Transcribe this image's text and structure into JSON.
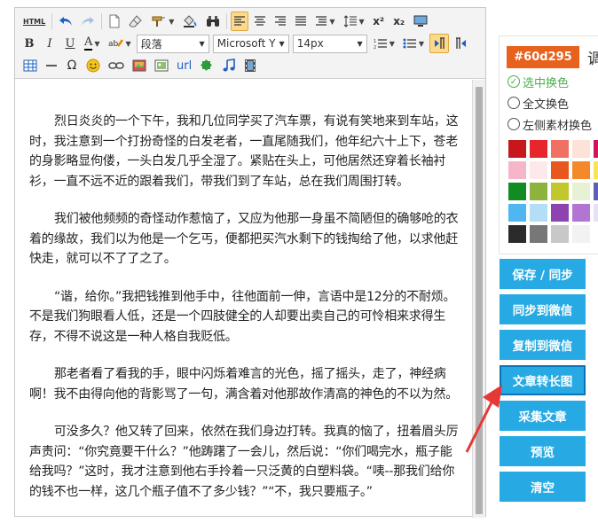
{
  "toolbar": {
    "html_label": "HTML",
    "paragraph_select": "段落",
    "font_select": "Microsoft Y",
    "size_select": "14px",
    "url_label": "url",
    "superscript": "x²",
    "subscript": "x₂",
    "omega": "Ω"
  },
  "content": {
    "paragraphs": [
      "烈日炎炎的一个下午，我和几位同学买了汽车票，有说有笑地来到车站，这时，我注意到一个打扮奇怪的白发老者，一直尾随我们，他年纪六十上下，苍老的身影略显佝偻，一头白发几乎全湿了。紧贴在头上，可他居然还穿着长袖衬衫，一直不远不近的跟着我们，带我们到了车站，总在我们周围打转。",
      "我们被他频频的奇怪动作惹恼了，又应为他那一身虽不简陋但的确够呛的衣着的缘故，我们以为他是一个乞丐，便都把买汽水剩下的钱掏给了他，以求他赶快走，就可以不了了之了。",
      "“谐，给你。”我把钱推到他手中，往他面前一伸，言语中是12分的不耐烦。不是我们狗眼看人低，还是一个四肢健全的人却要出卖自己的可怜相来求得生存，不得不说这是一种人格自我贬低。",
      "那老者看了看我的手，眼中闪烁着难言的光色，摇了摇头，走了，神经病啊！我不由得向他的背影骂了一句，满含着对他那故作清高的神色的不以为然。",
      "可没多久？他又转了回来，依然在我们身边打转。我真的恼了，扭着眉头厉声责问：“你究竟要干什么？”他踌躇了一会儿，然后说：“你们喝完水，瓶子能给我吗？”这时，我才注意到他右手拎着一只泛黄的白塑料袋。“咦--那我们给你的钱不也一样，这几个瓶子值不了多少钱？”“不，我只要瓶子。”"
    ]
  },
  "color_panel": {
    "hex_value": "#60d295",
    "cut_label": "调",
    "options": [
      "选中换色",
      "全文换色",
      "左侧素材换色"
    ],
    "selected_option": 0,
    "check_mark": "✓",
    "swatches": [
      [
        "#c8161d",
        "#e6262c",
        "#f07064",
        "#fde2d6",
        "#d0155c"
      ],
      [
        "#f5b6c8",
        "#fde8ea",
        "#e8581e",
        "#f5892a",
        "#fbe34b"
      ],
      [
        "#128b22",
        "#8db33e",
        "#c3c72e",
        "#e6f2d3",
        "#5b5fb5"
      ],
      [
        "#4fb6f2",
        "#b2dff5",
        "#8e44b0",
        "#b276d2",
        "#e8e0f5"
      ],
      [
        "#2b2b2b",
        "#777777",
        "#c8c8c8",
        "#f2f2f2",
        "#ffffff"
      ]
    ]
  },
  "side_buttons": [
    "保存 / 同步",
    "同步到微信",
    "复制到微信",
    "文章转长图",
    "采集文章",
    "预览",
    "清空"
  ],
  "accent_colors": {
    "button_blue": "#27aae3",
    "hex_orange": "#e8611d",
    "arrow_red": "#e53935",
    "check_green": "#4caf50"
  }
}
